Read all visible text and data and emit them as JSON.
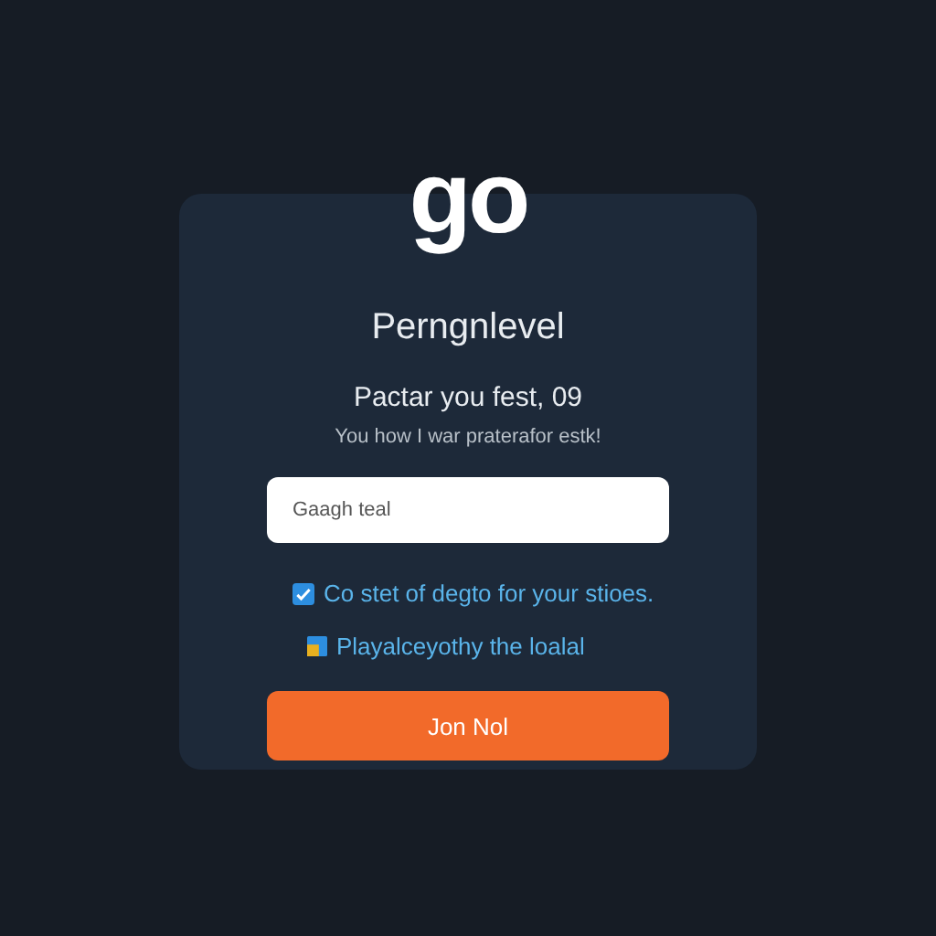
{
  "logo": "go",
  "title": "Perngnlevel",
  "heading": "Pactar you fest, 09",
  "subtitle": "You how I war praterafor estk!",
  "input": {
    "value": "Gaagh teal"
  },
  "options": [
    {
      "kind": "checkbox",
      "label": "Co stet of degto for your stioes.",
      "checked": true
    },
    {
      "kind": "badge",
      "label": "Playalceyothy the loalal"
    }
  ],
  "button": "Jon Nol"
}
